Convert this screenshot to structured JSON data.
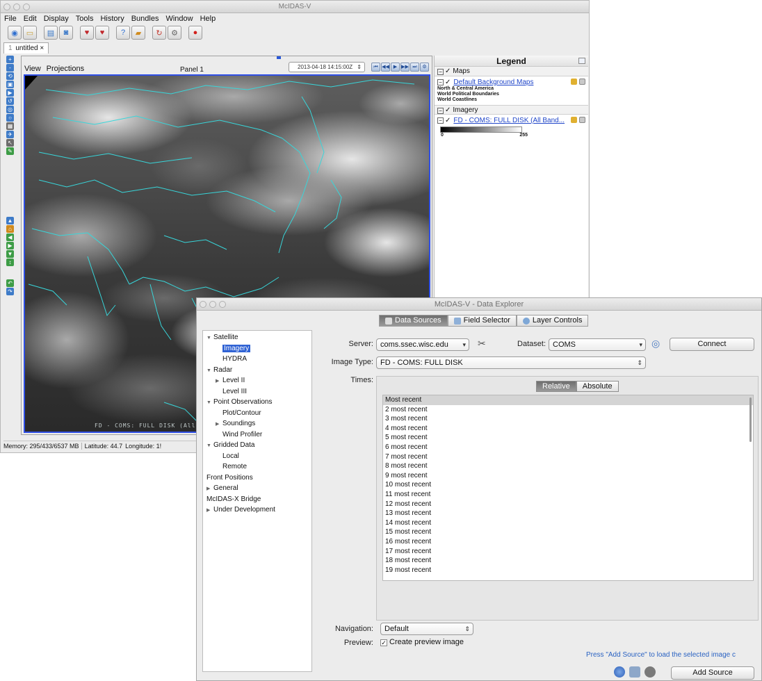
{
  "main_window": {
    "title": "McIDAS-V",
    "menu": [
      "File",
      "Edit",
      "Display",
      "Tools",
      "History",
      "Bundles",
      "Window",
      "Help"
    ],
    "tab": {
      "number": "1",
      "label": "untitled",
      "close": "×"
    }
  },
  "view": {
    "menu": [
      "View",
      "Projections"
    ],
    "panel_title": "Panel 1",
    "time": "2013-04-18 14:15:00Z",
    "anim_controls": [
      "⏮",
      "◀◀",
      "▶",
      "▶▶",
      "⏭",
      "⚙"
    ],
    "overlay_text": "FD - COMS: FULL DISK (All B"
  },
  "legend": {
    "title": "Legend",
    "groups": [
      {
        "label": "Maps",
        "layer": "Default Background Maps",
        "items": [
          "North & Central America",
          "World Political Boundaries",
          "World Coastlines"
        ]
      },
      {
        "label": "Imagery",
        "layer": "FD - COMS: FULL DISK (All Band...",
        "colorbar_min": "0",
        "colorbar_max": "255"
      }
    ]
  },
  "status": {
    "memory": "Memory: 295/433/6537 MB",
    "latitude": "Latitude:  44.7",
    "longitude": "Longitude:  1!"
  },
  "data_explorer": {
    "title": "McIDAS-V - Data Explorer",
    "tabs": [
      "Data Sources",
      "Field Selector",
      "Layer Controls"
    ],
    "tree": [
      {
        "label": "Satellite",
        "level": 0,
        "expanded": true
      },
      {
        "label": "Imagery",
        "level": 1,
        "selected": true
      },
      {
        "label": "HYDRA",
        "level": 1
      },
      {
        "label": "Radar",
        "level": 0,
        "expanded": true
      },
      {
        "label": "Level II",
        "level": 2,
        "collapsed": true
      },
      {
        "label": "Level III",
        "level": 1
      },
      {
        "label": "Point Observations",
        "level": 0,
        "expanded": true
      },
      {
        "label": "Plot/Contour",
        "level": 1
      },
      {
        "label": "Soundings",
        "level": 2,
        "collapsed": true
      },
      {
        "label": "Wind Profiler",
        "level": 1
      },
      {
        "label": "Gridded Data",
        "level": 0,
        "expanded": true
      },
      {
        "label": "Local",
        "level": 1
      },
      {
        "label": "Remote",
        "level": 1
      },
      {
        "label": "Front Positions",
        "level": 0,
        "leaf": true
      },
      {
        "label": "General",
        "level": 0,
        "collapsed": true
      },
      {
        "label": "McIDAS-X Bridge",
        "level": 0,
        "leaf": true
      },
      {
        "label": "Under Development",
        "level": 0,
        "collapsed": true
      }
    ],
    "server_label": "Server:",
    "server_value": "coms.ssec.wisc.edu",
    "dataset_label": "Dataset:",
    "dataset_value": "COMS",
    "connect_label": "Connect",
    "image_type_label": "Image Type:",
    "image_type_value": "FD - COMS: FULL DISK",
    "times_label": "Times:",
    "times_modes": [
      "Relative",
      "Absolute"
    ],
    "times": [
      "Most recent",
      "2 most recent",
      "3 most recent",
      "4 most recent",
      "5 most recent",
      "6 most recent",
      "7 most recent",
      "8 most recent",
      "9 most recent",
      "10 most recent",
      "11 most recent",
      "12 most recent",
      "13 most recent",
      "14 most recent",
      "15 most recent",
      "16 most recent",
      "17 most recent",
      "18 most recent",
      "19 most recent"
    ],
    "navigation_label": "Navigation:",
    "navigation_value": "Default",
    "preview_label": "Preview:",
    "preview_checkbox": "Create preview image",
    "hint": "Press \"Add Source\" to load the selected image c",
    "add_source_label": "Add Source"
  }
}
